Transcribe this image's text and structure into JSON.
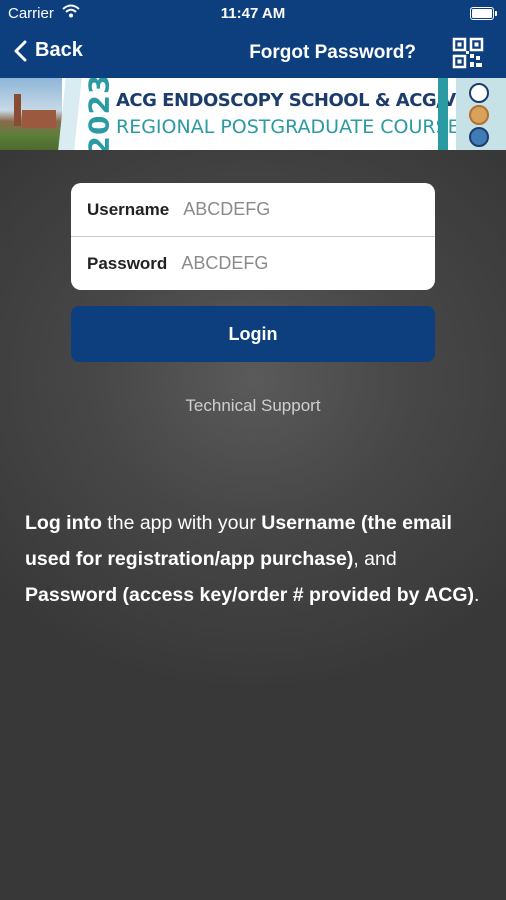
{
  "status_bar": {
    "carrier": "Carrier",
    "time": "11:47 AM"
  },
  "nav": {
    "back_label": "Back",
    "forgot_label": "Forgot Password?"
  },
  "banner": {
    "year": "2023",
    "line1": "ACG ENDOSCOPY SCHOOL & ACG/VGS/ODSGNA",
    "line2": "REGIONAL POSTGRADUATE COURSE"
  },
  "form": {
    "username_label": "Username",
    "username_placeholder": "ABCDEFG",
    "password_label": "Password",
    "password_placeholder": "ABCDEFG"
  },
  "login_label": "Login",
  "support_label": "Technical Support",
  "info": {
    "part1_bold": "Log into",
    "part2": " the app with your ",
    "part3_bold": "Username (the email used for registration/app purchase)",
    "part4": ", and ",
    "part5_bold": "Password (access key/order # provided by ACG)",
    "part6": "."
  },
  "colors": {
    "nav_blue": "#0d3f7f",
    "teal": "#2a9aa3",
    "background": "#474747"
  }
}
